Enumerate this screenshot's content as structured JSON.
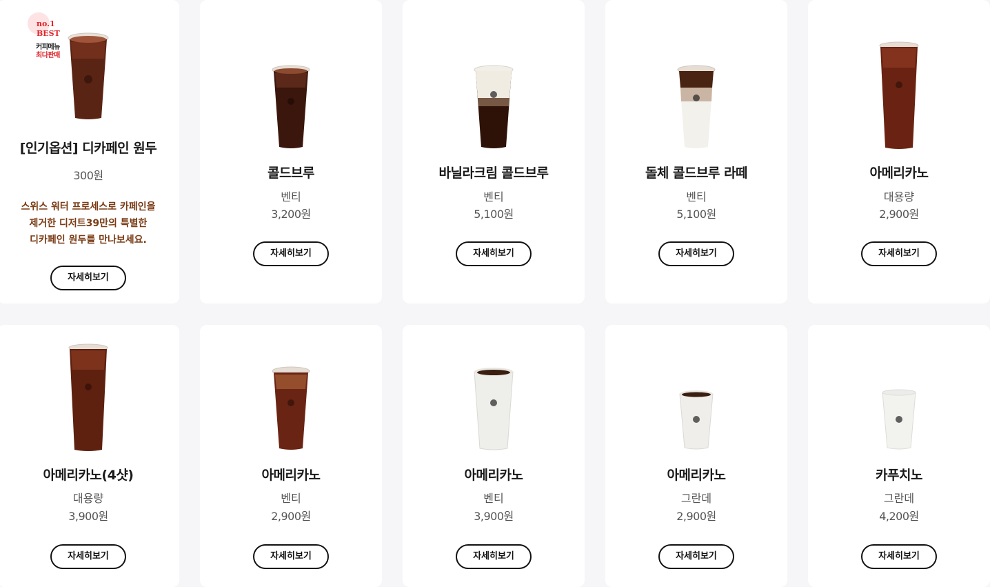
{
  "detail_label": "자세히보기",
  "badge": {
    "line1": "no.1",
    "line2": "BEST",
    "line3": "커피메뉴",
    "line4": "최다판매"
  },
  "featured": {
    "name": "[인기옵션] 디카페인 원두",
    "price": "300원",
    "description": [
      "스위스 워터 프로세스로 카페인을",
      "제거한 디저트39만의 특별한",
      "디카페인 원두를 만나보세요."
    ],
    "icon": "iced-coffee-cup-icon"
  },
  "products": [
    {
      "name": "콜드브루",
      "size": "벤티",
      "price": "3,200원",
      "icon": "iced-cold-brew-cup-icon"
    },
    {
      "name": "바닐라크림 콜드브루",
      "size": "벤티",
      "price": "5,100원",
      "icon": "vanilla-cream-cold-brew-cup-icon"
    },
    {
      "name": "돌체 콜드브루 라떼",
      "size": "벤티",
      "price": "5,100원",
      "icon": "dolce-cold-brew-latte-cup-icon"
    },
    {
      "name": "아메리카노",
      "size": "대용량",
      "price": "2,900원",
      "icon": "iced-americano-cup-icon"
    },
    {
      "name": "아메리카노(4샷)",
      "size": "대용량",
      "price": "3,900원",
      "icon": "iced-americano-cup-icon"
    },
    {
      "name": "아메리카노",
      "size": "벤티",
      "price": "2,900원",
      "icon": "iced-americano-cup-icon"
    },
    {
      "name": "아메리카노",
      "size": "벤티",
      "price": "3,900원",
      "icon": "hot-coffee-cup-icon"
    },
    {
      "name": "아메리카노",
      "size": "그란데",
      "price": "2,900원",
      "icon": "hot-coffee-cup-icon"
    },
    {
      "name": "카푸치노",
      "size": "그란데",
      "price": "4,200원",
      "icon": "hot-cup-with-lid-icon"
    }
  ],
  "colors": {
    "background": "#f6f6f8",
    "card": "#ffffff",
    "description_text": "#7a3b14",
    "badge_red": "#e0242b",
    "button_border": "#111111"
  }
}
